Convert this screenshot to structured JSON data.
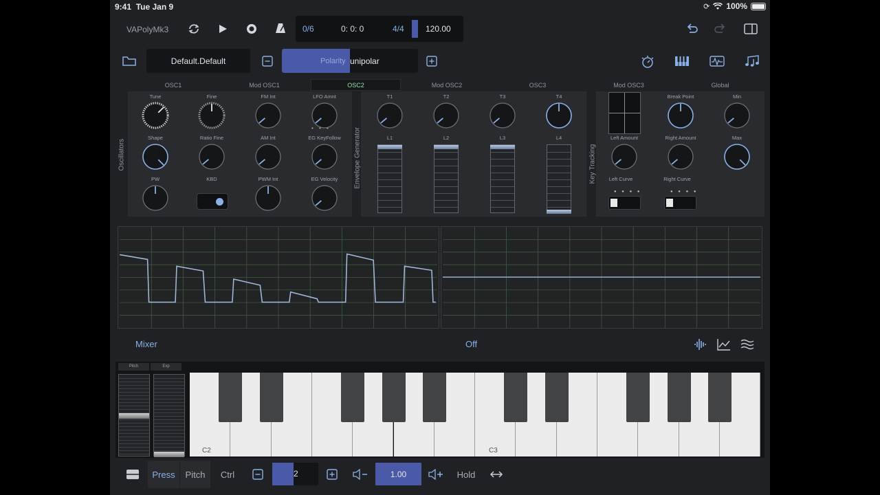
{
  "status_bar": {
    "time": "9:41",
    "date": "Tue Jan 9",
    "battery": "100%"
  },
  "toolbar": {
    "app_name": "VAPolyMk3",
    "voices": "0/6",
    "position": "0: 0: 0",
    "time_signature": "4/4",
    "tempo": "120.00",
    "icons": [
      "loop-icon",
      "play-icon",
      "record-icon",
      "metronome-icon",
      "undo-icon",
      "redo-icon",
      "sidebar-icon"
    ]
  },
  "preset_bar": {
    "preset_name": "Default.Default",
    "param_name": "Polarity",
    "param_value": "unipolar",
    "param_fill": 0.5,
    "view_icons": [
      "clock-icon",
      "piano-icon",
      "scope-icon",
      "notes-icon"
    ]
  },
  "tabs": [
    "OSC1",
    "Mod OSC1",
    "OSC2",
    "Mod OSC2",
    "OSC3",
    "Mod OSC3",
    "Global"
  ],
  "active_tab": "OSC2",
  "oscillators": {
    "section_label": "Oscillators",
    "row1": [
      "Tune",
      "Fine",
      "FM Int",
      "LFO Amnt"
    ],
    "row2": [
      "Shape",
      "Ratio Fine",
      "AM Int",
      "EG KeyFollow"
    ],
    "row3": [
      "PW",
      "KBD",
      "PWM Int",
      "EG Velocity"
    ]
  },
  "envelope": {
    "section_label": "Envelope Generator",
    "times": [
      "T1",
      "T2",
      "T3",
      "T4"
    ],
    "levels": [
      "L1",
      "L2",
      "L3",
      "L4"
    ],
    "level_values": [
      1.0,
      1.0,
      1.0,
      0.0
    ]
  },
  "key_tracking": {
    "section_label": "Key Tracking",
    "labels": [
      "Break Point",
      "Min",
      "Left Amount",
      "Right Amount",
      "Max",
      "Left Curve",
      "Right Curve"
    ]
  },
  "scope": {
    "mixer_label": "Mixer",
    "mode": "Off"
  },
  "keyboard": {
    "wheel_labels": [
      "Pitch",
      "Exp"
    ],
    "note_labels": [
      "C2",
      "C3"
    ]
  },
  "bottom_bar": {
    "press": "Press",
    "pitch": "Pitch",
    "ctrl": "Ctrl",
    "octave": "2",
    "volume": "1.00",
    "hold": "Hold"
  },
  "colors": {
    "accent": "#4a5aa8",
    "background": "#202124",
    "waveform": "#9fb8d8",
    "active_tab": "#8fe0a8"
  }
}
